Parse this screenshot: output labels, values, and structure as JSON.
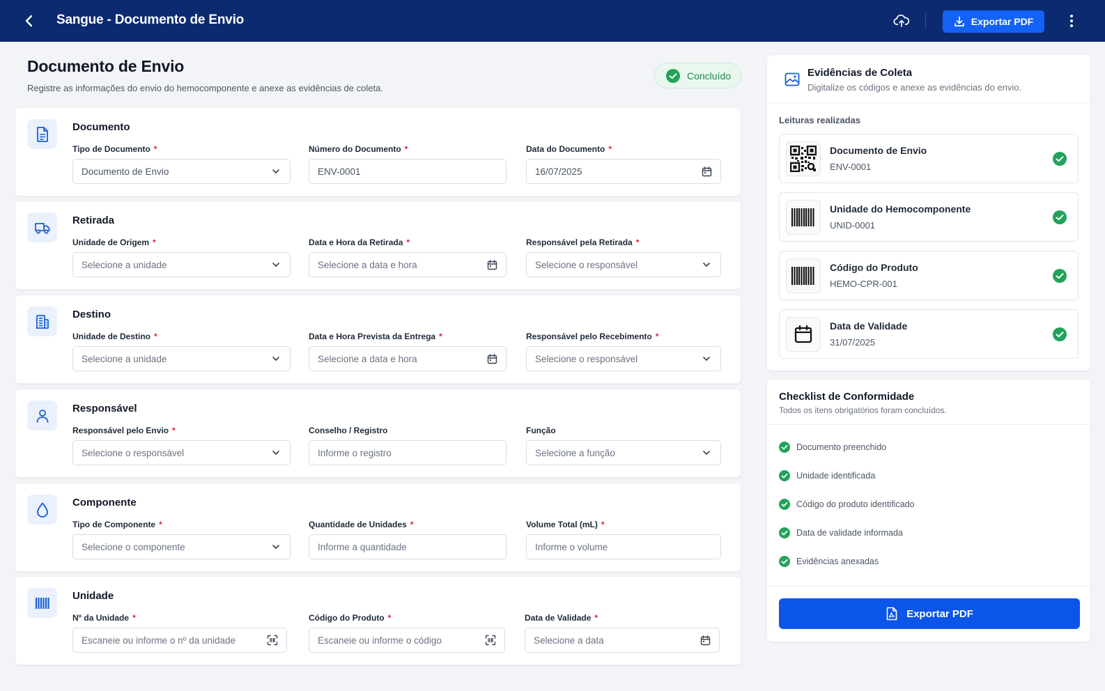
{
  "topbar": {
    "title": "Sangue - Documento de Envio",
    "export_label": "Exportar PDF"
  },
  "header": {
    "title": "Documento de Envio",
    "subtitle": "Registre as informações do envio do hemocomponente e anexe as evidências de coleta.",
    "status": "Concluído"
  },
  "sections": {
    "documento": {
      "title": "Documento",
      "f1_label": "Tipo de Documento",
      "f1_value": "Documento de Envio",
      "f2_label": "Número do Documento",
      "f2_value": "ENV-0001",
      "f3_label": "Data do Documento",
      "f3_value": "16/07/2025"
    },
    "retirada": {
      "title": "Retirada",
      "f1_label": "Unidade de Origem",
      "f1_placeholder": "Selecione a unidade",
      "f2_label": "Data e Hora da Retirada",
      "f2_placeholder": "Selecione a data e hora",
      "f3_label": "Responsável pela Retirada",
      "f3_placeholder": "Selecione o responsável"
    },
    "destino": {
      "title": "Destino",
      "f1_label": "Unidade de Destino",
      "f1_placeholder": "Selecione a unidade",
      "f2_label": "Data e Hora Prevista da Entrega",
      "f2_placeholder": "Selecione a data e hora",
      "f3_label": "Responsável pelo Recebimento",
      "f3_placeholder": "Selecione o responsável"
    },
    "responsavel": {
      "title": "Responsável",
      "f1_label": "Responsável pelo Envio",
      "f1_placeholder": "Selecione o responsável",
      "f2_label": "Conselho / Registro",
      "f2_placeholder": "Informe o registro",
      "f3_label": "Função",
      "f3_placeholder": "Selecione a função"
    },
    "componente": {
      "title": "Componente",
      "f1_label": "Tipo de Componente",
      "f1_placeholder": "Selecione o componente",
      "f2_label": "Quantidade de Unidades",
      "f2_placeholder": "Informe a quantidade",
      "f3_label": "Volume Total (mL)",
      "f3_placeholder": "Informe o volume"
    },
    "unidade": {
      "title": "Unidade",
      "f1_label": "Nº da Unidade",
      "f1_placeholder": "Escaneie ou informe o nº da unidade",
      "f2_label": "Código do Produto",
      "f2_placeholder": "Escaneie ou informe o código",
      "f3_label": "Data de Validade",
      "f3_placeholder": "Selecione a data"
    }
  },
  "evidencias": {
    "title": "Evidências de Coleta",
    "subtitle": "Digitalize os códigos e anexe as evidências do envio.",
    "readings_label": "Leituras realizadas",
    "readings": [
      {
        "title": "Documento de Envio",
        "code": "ENV-0001",
        "icon": "qr-code-icon"
      },
      {
        "title": "Unidade do Hemocomponente",
        "code": "UNID-0001",
        "icon": "barcode-icon"
      },
      {
        "title": "Código do Produto",
        "code": "HEMO-CPR-001",
        "icon": "barcode-icon"
      },
      {
        "title": "Data de Validade",
        "code": "31/07/2025",
        "icon": "calendar-icon"
      }
    ]
  },
  "checklist": {
    "title": "Checklist de Conformidade",
    "subtitle": "Todos os itens obrigatórios foram concluídos.",
    "items": [
      "Documento preenchido",
      "Unidade identificada",
      "Código do produto identificado",
      "Data de validade informada",
      "Evidências anexadas"
    ],
    "export_label": "Exportar PDF"
  },
  "colors": {
    "topbar": "#0b2a6f",
    "accent": "#1462f5",
    "success": "#22a35a",
    "required": "#e11d2e"
  }
}
